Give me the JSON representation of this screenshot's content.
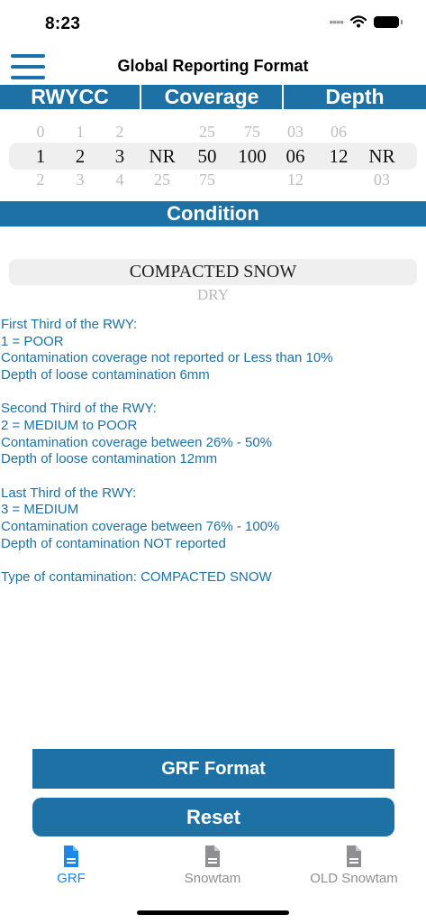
{
  "status_bar": {
    "time": "8:23"
  },
  "nav": {
    "title": "Global Reporting Format"
  },
  "columns": {
    "rwycc": "RWYCC",
    "coverage": "Coverage",
    "depth": "Depth"
  },
  "picker": {
    "wheels": [
      {
        "above": "0",
        "selected": "1",
        "below": "2"
      },
      {
        "above": "1",
        "selected": "2",
        "below": "3"
      },
      {
        "above": "2",
        "selected": "3",
        "below": "4"
      },
      {
        "above": "",
        "selected": "NR",
        "below": "25"
      },
      {
        "above": "25",
        "selected": "50",
        "below": "75"
      },
      {
        "above": "75",
        "selected": "100",
        "below": ""
      },
      {
        "above": "03",
        "selected": "06",
        "below": "12"
      },
      {
        "above": "06",
        "selected": "12",
        "below": ""
      },
      {
        "above": "",
        "selected": "NR",
        "below": "03"
      }
    ]
  },
  "condition": {
    "label": "Condition",
    "selected": "COMPACTED SNOW",
    "next": "DRY"
  },
  "report": {
    "first": [
      "First Third of the RWY:",
      "1 = POOR",
      "Contamination coverage not reported or Less than 10%",
      "Depth of loose contamination 6mm"
    ],
    "second": [
      "Second Third of the RWY:",
      "2 = MEDIUM to POOR",
      "Contamination coverage between 26% - 50%",
      "Depth of loose contamination 12mm"
    ],
    "last": [
      "Last Third of the RWY:",
      "3 = MEDIUM",
      "Contamination coverage between 76% - 100%",
      "Depth of contamination NOT reported"
    ],
    "type": "Type of contamination: COMPACTED SNOW"
  },
  "buttons": {
    "grf_format": "GRF Format",
    "reset": "Reset"
  },
  "tabs": [
    {
      "label": "GRF",
      "icon": "document-icon",
      "active": true
    },
    {
      "label": "Snowtam",
      "icon": "document-icon",
      "active": false
    },
    {
      "label": "OLD Snowtam",
      "icon": "document-icon",
      "active": false
    }
  ],
  "colors": {
    "accent": "#1e71a5",
    "active_tab": "#1e86e6",
    "inactive_tab": "#8e8e93"
  }
}
